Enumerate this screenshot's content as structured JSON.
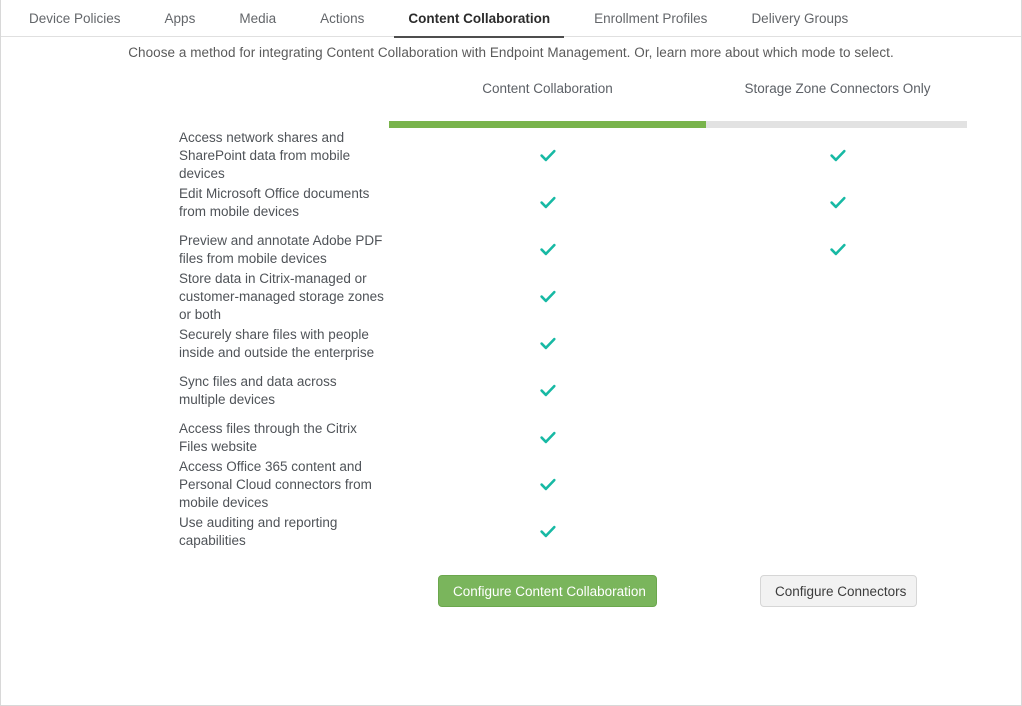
{
  "tabs": [
    {
      "label": "Device Policies",
      "active": false
    },
    {
      "label": "Apps",
      "active": false
    },
    {
      "label": "Media",
      "active": false
    },
    {
      "label": "Actions",
      "active": false
    },
    {
      "label": "Content Collaboration",
      "active": true
    },
    {
      "label": "Enrollment Profiles",
      "active": false
    },
    {
      "label": "Delivery Groups",
      "active": false
    }
  ],
  "subtitle": "Choose a method for integrating Content Collaboration with Endpoint Management. Or, learn more about which mode to select.",
  "columns": {
    "left": "Content Collaboration",
    "right": "Storage Zone Connectors Only"
  },
  "colors": {
    "mode_bar_fill": "#79b44c",
    "mode_bar_track": "#e2e2e2",
    "check": "#17b9a4",
    "primary_button": "#7ab55c",
    "secondary_button": "#f2f2f2",
    "active_tab_underline": "#4d4d4d"
  },
  "features": [
    {
      "label": "Access network shares and SharePoint data from mobile devices",
      "content_collaboration": true,
      "storage_zone_connectors_only": true
    },
    {
      "label": "Edit Microsoft Office documents from mobile devices",
      "content_collaboration": true,
      "storage_zone_connectors_only": true
    },
    {
      "label": "Preview and annotate Adobe PDF files from mobile devices",
      "content_collaboration": true,
      "storage_zone_connectors_only": true
    },
    {
      "label": "Store data in Citrix-managed or customer-managed storage zones or both",
      "content_collaboration": true,
      "storage_zone_connectors_only": false
    },
    {
      "label": "Securely share files with people inside and outside the enterprise",
      "content_collaboration": true,
      "storage_zone_connectors_only": false
    },
    {
      "label": "Sync files and data across multiple devices",
      "content_collaboration": true,
      "storage_zone_connectors_only": false
    },
    {
      "label": "Access files through the Citrix Files website",
      "content_collaboration": true,
      "storage_zone_connectors_only": false
    },
    {
      "label": "Access Office 365 content and Personal Cloud connectors from mobile devices",
      "content_collaboration": true,
      "storage_zone_connectors_only": false
    },
    {
      "label": "Use auditing and reporting capabilities",
      "content_collaboration": true,
      "storage_zone_connectors_only": false
    }
  ],
  "actions": {
    "primary_label": "Configure Content Collaboration",
    "secondary_label": "Configure Connectors"
  },
  "icons": {
    "check": "check-icon"
  }
}
